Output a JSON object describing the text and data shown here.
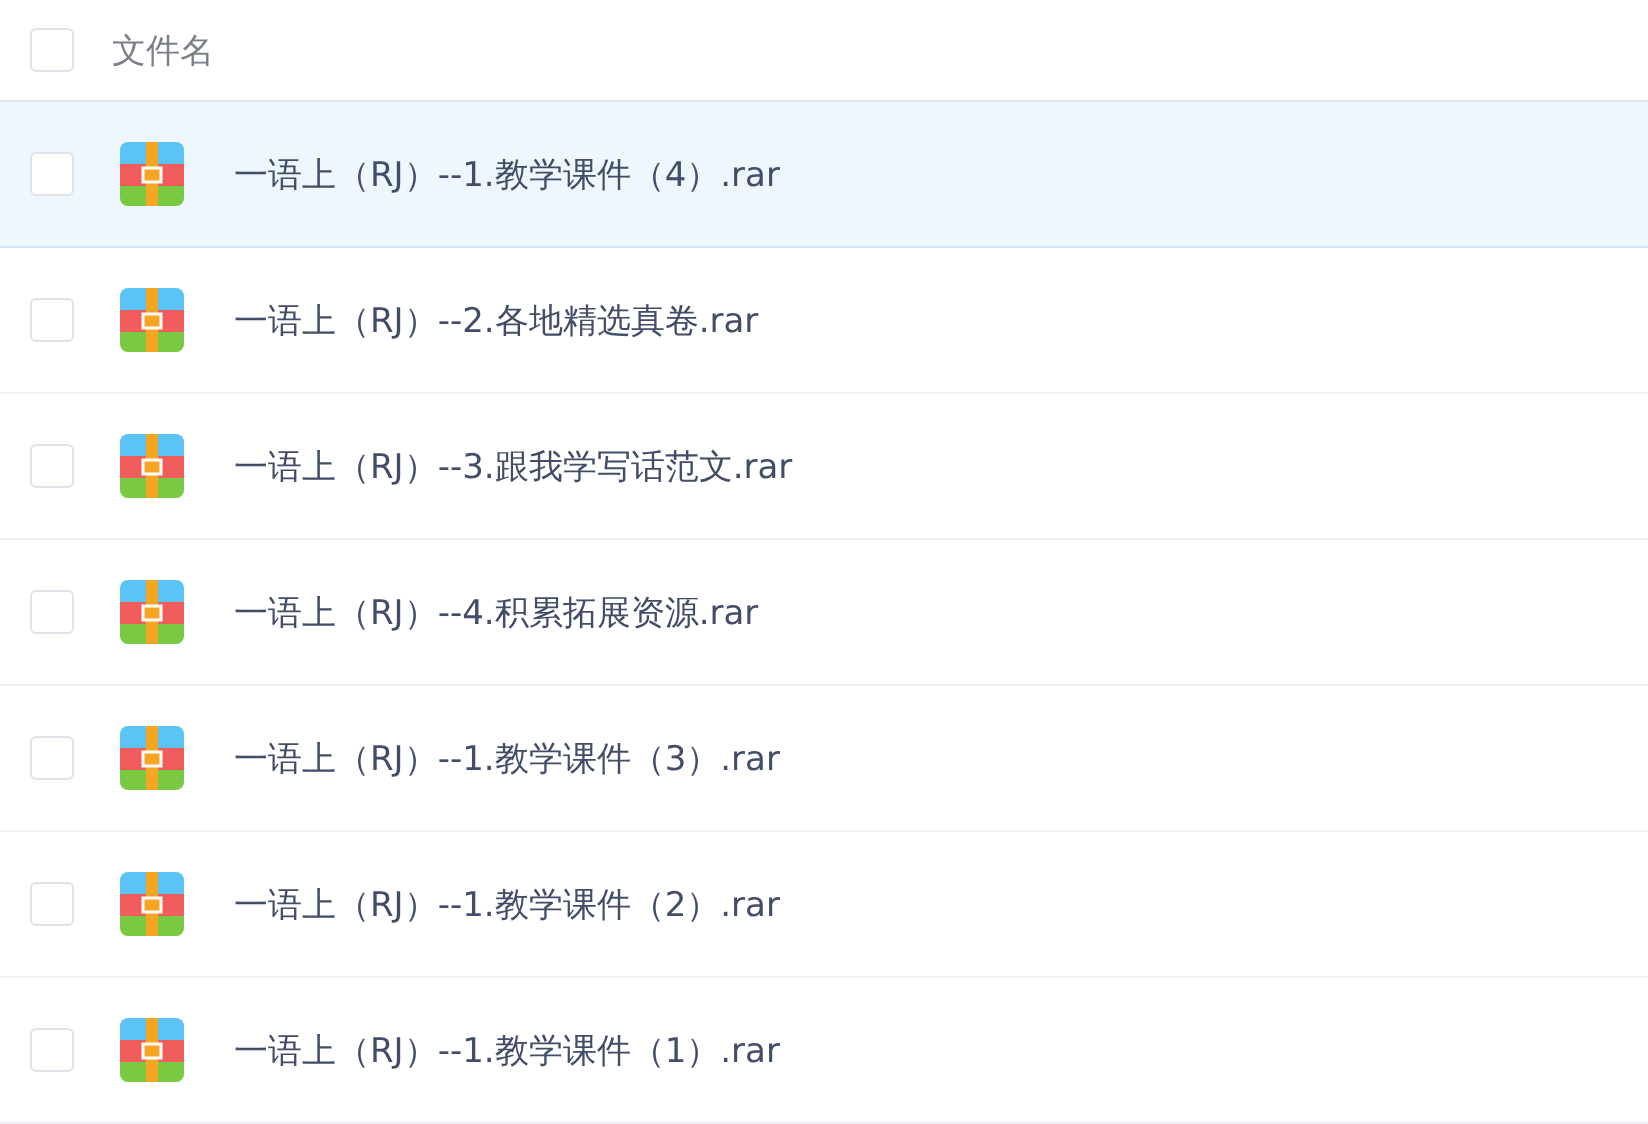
{
  "header": {
    "checked": false,
    "label": "文件名"
  },
  "files": [
    {
      "name": "一语上（RJ）--1.教学课件（4）.rar",
      "selected": true,
      "checked": false
    },
    {
      "name": "一语上（RJ）--2.各地精选真卷.rar",
      "selected": false,
      "checked": false
    },
    {
      "name": "一语上（RJ）--3.跟我学写话范文.rar",
      "selected": false,
      "checked": false
    },
    {
      "name": "一语上（RJ）--4.积累拓展资源.rar",
      "selected": false,
      "checked": false
    },
    {
      "name": "一语上（RJ）--1.教学课件（3）.rar",
      "selected": false,
      "checked": false
    },
    {
      "name": "一语上（RJ）--1.教学课件（2）.rar",
      "selected": false,
      "checked": false
    },
    {
      "name": "一语上（RJ）--1.教学课件（1）.rar",
      "selected": false,
      "checked": false
    }
  ]
}
